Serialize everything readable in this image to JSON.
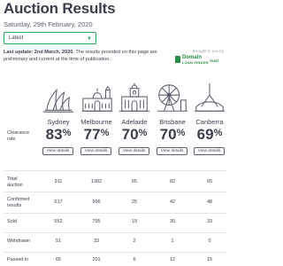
{
  "page": {
    "title": "Auction Results",
    "date": "Saturday, 29th February, 2020",
    "filter": {
      "selected": "Latest"
    },
    "brought_by": "Brought to you by",
    "logo": {
      "line1": "Domain",
      "line2": "LOAN FINDER",
      "side": "Aust"
    },
    "update_label": "Last update: 2nd March, 2020.",
    "update_text": " The results provided on this page are preliminary and current at the time of publication."
  },
  "table": {
    "clearance_label": "Clearance rate",
    "view_label": "View details",
    "cities": [
      {
        "name": "Sydney",
        "clearance": "83",
        "icon": "opera-house-icon"
      },
      {
        "name": "Melbourne",
        "clearance": "77",
        "icon": "flinders-station-icon"
      },
      {
        "name": "Adelaide",
        "clearance": "70",
        "icon": "adelaide-building-icon"
      },
      {
        "name": "Brisbane",
        "clearance": "70",
        "icon": "brisbane-wheel-icon"
      },
      {
        "name": "Canberra",
        "clearance": "69",
        "icon": "canberra-parliament-icon"
      }
    ],
    "rows": [
      {
        "label": "Total auction",
        "values": [
          "911",
          "1382",
          "65",
          "82",
          "65"
        ]
      },
      {
        "label": "Confirmed results",
        "values": [
          "617",
          "996",
          "25",
          "42",
          "48"
        ]
      },
      {
        "label": "Sold",
        "values": [
          "552",
          "795",
          "19",
          "30",
          "33"
        ]
      },
      {
        "label": "Withdrawn",
        "values": [
          "51",
          "33",
          "2",
          "1",
          "0"
        ]
      },
      {
        "label": "Passed in",
        "values": [
          "65",
          "201",
          "6",
          "12",
          "15"
        ]
      }
    ]
  }
}
